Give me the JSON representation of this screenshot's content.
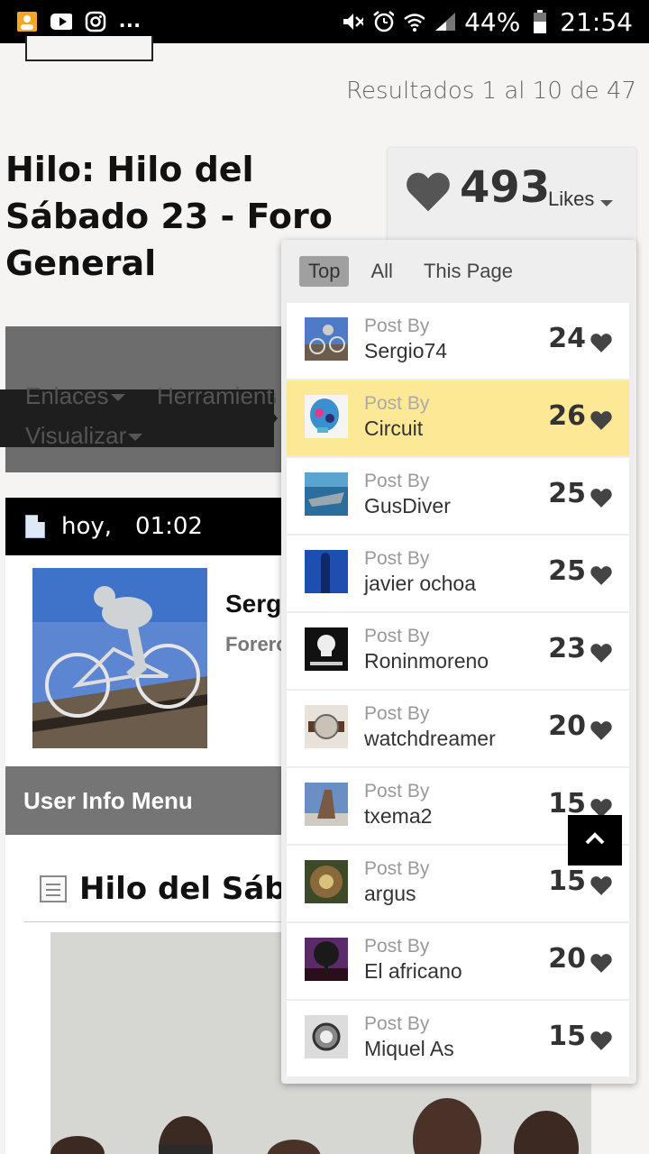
{
  "status_bar": {
    "battery": "44%",
    "time": "21:54",
    "notifications_more": "..."
  },
  "results": "Resultados 1 al 10 de 47",
  "thread_title": "Hilo: Hilo del Sábado 23 - Foro General",
  "likes": {
    "count": "493",
    "label": "Likes",
    "heart_color": "#555555"
  },
  "toolbar": {
    "links": "Enlaces",
    "tools": "Herramientas",
    "display": "Visualizar"
  },
  "post": {
    "date": "hoy,",
    "time": "01:02",
    "poster_name": "Serg",
    "poster_rank": "Forero",
    "user_info_menu": "User Info Menu",
    "title": "Hilo del Sábado"
  },
  "dropdown": {
    "tabs": [
      "Top",
      "All",
      "This Page"
    ],
    "active_tab": "Top",
    "post_by_label": "Post By",
    "highlight_color": "#fde995",
    "rows": [
      {
        "user": "Sergio74",
        "count": "24"
      },
      {
        "user": "Circuit",
        "count": "26"
      },
      {
        "user": "GusDiver",
        "count": "25"
      },
      {
        "user": "javier ochoa",
        "count": "25"
      },
      {
        "user": "Roninmoreno",
        "count": "23"
      },
      {
        "user": "watchdreamer",
        "count": "20"
      },
      {
        "user": "txema2",
        "count": "15"
      },
      {
        "user": "argus",
        "count": "15"
      },
      {
        "user": "El africano",
        "count": "20"
      },
      {
        "user": "Miquel As",
        "count": "15"
      }
    ]
  }
}
